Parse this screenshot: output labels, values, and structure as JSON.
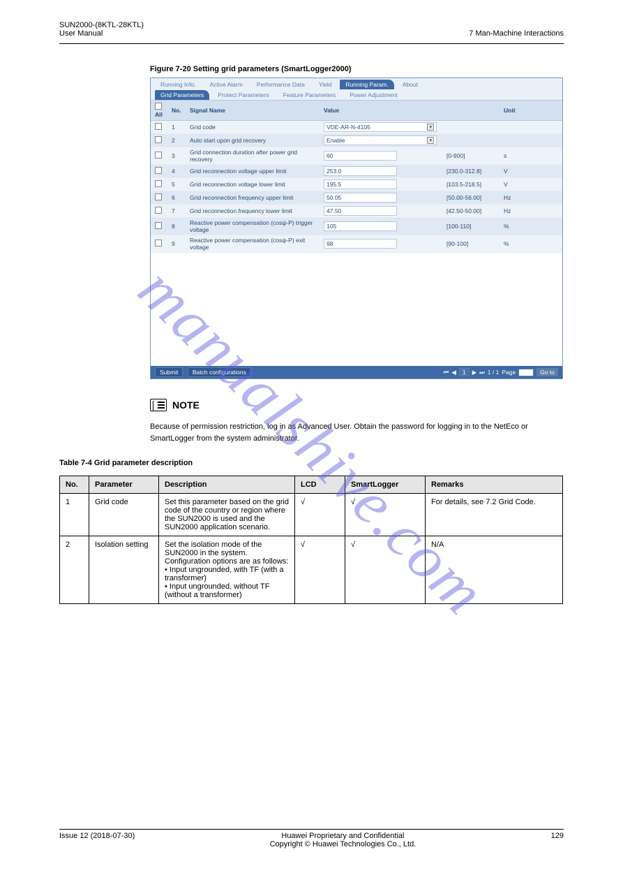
{
  "header": {
    "left_line1": "SUN2000-(8KTL-28KTL)",
    "left_line2": "User Manual",
    "right": "7 Man-Machine Interactions"
  },
  "figure_caption": "Figure 7-20 Setting grid parameters (SmartLogger2000)",
  "app": {
    "tabs1": [
      "Running Info.",
      "Active Alarm",
      "Performance Data",
      "Yield",
      "Running Param.",
      "About"
    ],
    "tabs1_active": "Running Param.",
    "tabs2": [
      "Grid Parameters",
      "Protect Parameters",
      "Feature Parameters",
      "Power Adjustment"
    ],
    "tabs2_active": "Grid Parameters",
    "columns": {
      "all": "All",
      "no": "No.",
      "signal": "Signal Name",
      "value": "Value",
      "unit": "Unit"
    },
    "rows": [
      {
        "no": "1",
        "signal": "Grid code",
        "value": "VDE-AR-N-4105",
        "range": "",
        "unit": "",
        "select": true
      },
      {
        "no": "2",
        "signal": "Auto start upon grid recovery",
        "value": "Enable",
        "range": "",
        "unit": "",
        "select": true
      },
      {
        "no": "3",
        "signal": "Grid connection duration after power grid recovery",
        "value": "60",
        "range": "[0-900]",
        "unit": "s"
      },
      {
        "no": "4",
        "signal": "Grid reconnection voltage upper limit",
        "value": "253.0",
        "range": "[230.0-312.8]",
        "unit": "V"
      },
      {
        "no": "5",
        "signal": "Grid reconnection voltage lower limit",
        "value": "195.5",
        "range": "[103.5-218.5]",
        "unit": "V"
      },
      {
        "no": "6",
        "signal": "Grid reconnection frequency upper limit",
        "value": "50.05",
        "range": "[50.00-56.00]",
        "unit": "Hz"
      },
      {
        "no": "7",
        "signal": "Grid reconnection frequency lower limit",
        "value": "47.50",
        "range": "[42.50-50.00]",
        "unit": "Hz"
      },
      {
        "no": "8",
        "signal": "Reactive power compensation (cosψ-P) trigger voltage",
        "value": "105",
        "range": "[100-110]",
        "unit": "%"
      },
      {
        "no": "9",
        "signal": "Reactive power compensation (cosψ-P) exit voltage",
        "value": "98",
        "range": "[90-100]",
        "unit": "%"
      }
    ],
    "footer": {
      "submit": "Submit",
      "batch": "Batch configurations",
      "pager_text": "1 / 1",
      "page_label": "Page",
      "go": "Go to"
    }
  },
  "note": {
    "label": "NOTE",
    "text": "Because of permission restriction, log in as Advanced User. Obtain the password for logging in to the NetEco or SmartLogger from the system administrator."
  },
  "doc_table": {
    "caption": "Table 7-4 Grid parameter description",
    "headers": [
      "No.",
      "Parameter",
      "Description",
      "LCD",
      "SmartLogger",
      "Remarks"
    ],
    "rows": [
      {
        "no": "1",
        "param": "Grid code",
        "desc": "Set this parameter based on the grid code of the country or region where the SUN2000 is used and the SUN2000 application scenario.",
        "lcd": "√",
        "smart": "√",
        "remarks": "For details, see 7.2 Grid Code."
      },
      {
        "no": "2",
        "param": "Isolation setting",
        "desc": "Set the isolation mode of the SUN2000 in the system. Configuration options are as follows:\n• Input ungrounded, with TF (with a transformer)\n• Input ungrounded, without TF (without a transformer)",
        "lcd": "√",
        "smart": "√",
        "remarks": "N/A"
      }
    ]
  },
  "footer": {
    "left": "Issue 12 (2018-07-30)",
    "center": "Huawei Proprietary and Confidential",
    "center2": "Copyright © Huawei Technologies Co., Ltd.",
    "right": "129"
  },
  "watermark": "manualshive.com"
}
